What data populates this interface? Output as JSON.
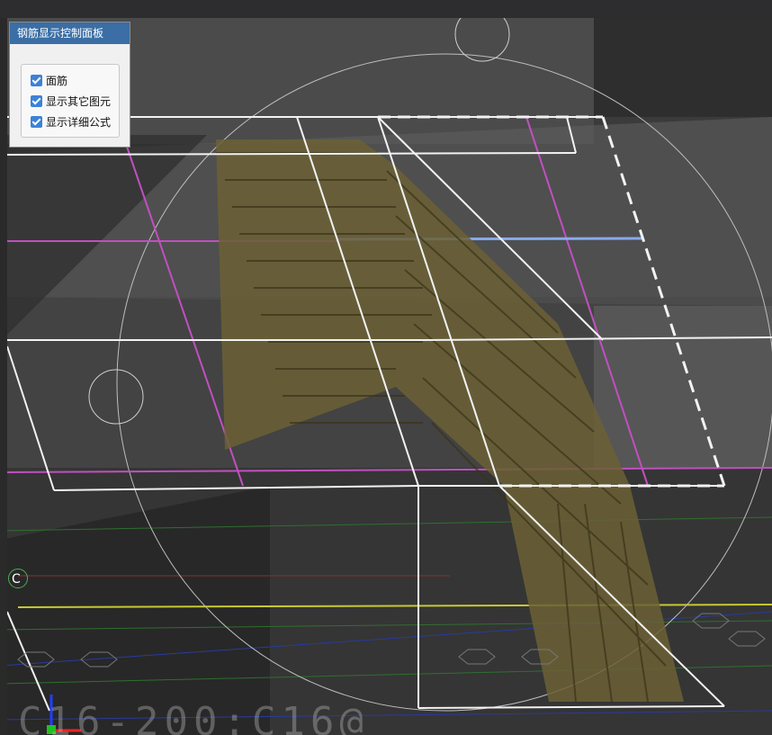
{
  "panel": {
    "title": "钢筋显示控制面板",
    "options": [
      {
        "label": "面筋",
        "checked": true
      },
      {
        "label": "显示其它图元",
        "checked": true
      },
      {
        "label": "显示详细公式",
        "checked": true
      }
    ]
  },
  "viewport": {
    "axis_label": "C",
    "background_text": "C16-200:C16@"
  },
  "colors": {
    "panel_title_bg": "#3b6ea5",
    "checkbox": "#3b82d6",
    "guide_magenta": "#c050c0",
    "highlight_blue": "#88aaee",
    "grid_yellow": "#c8c832",
    "rebar": "#7a6e3a"
  }
}
